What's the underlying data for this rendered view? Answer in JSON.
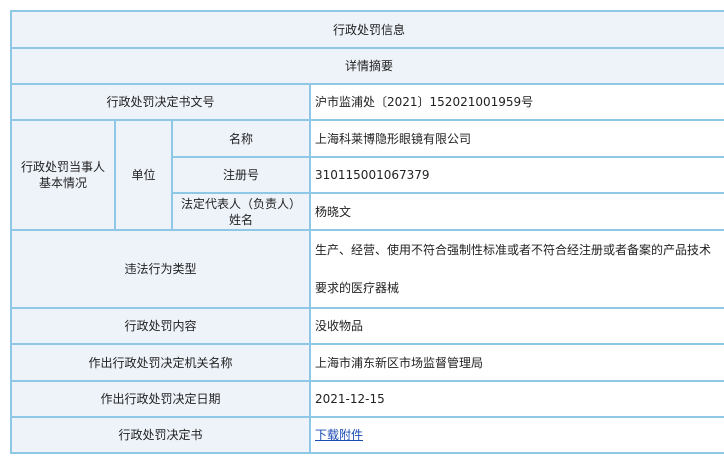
{
  "header": {
    "title": "行政处罚信息",
    "subtitle": "详情摘要"
  },
  "decision_number": {
    "label": "行政处罚决定书文号",
    "value": "沪市监浦处〔2021〕152021001959号"
  },
  "party": {
    "group_label": "行政处罚当事人基本情况",
    "unit_label": "单位",
    "name_label": "名称",
    "name_value": "上海科莱博隐形眼镜有限公司",
    "reg_label": "注册号",
    "reg_value": "310115001067379",
    "rep_label": "法定代表人（负责人）姓名",
    "rep_value": "杨晓文"
  },
  "violation": {
    "label": "违法行为类型",
    "value": "生产、经营、使用不符合强制性标准或者不符合经注册或者备案的产品技术要求的医疗器械"
  },
  "content": {
    "label": "行政处罚内容",
    "value": "没收物品"
  },
  "authority": {
    "label": "作出行政处罚决定机关名称",
    "value": "上海市浦东新区市场监督管理局"
  },
  "date": {
    "label": "作出行政处罚决定日期",
    "value": "2021-12-15"
  },
  "document": {
    "label": "行政处罚决定书",
    "link": "下载附件"
  }
}
